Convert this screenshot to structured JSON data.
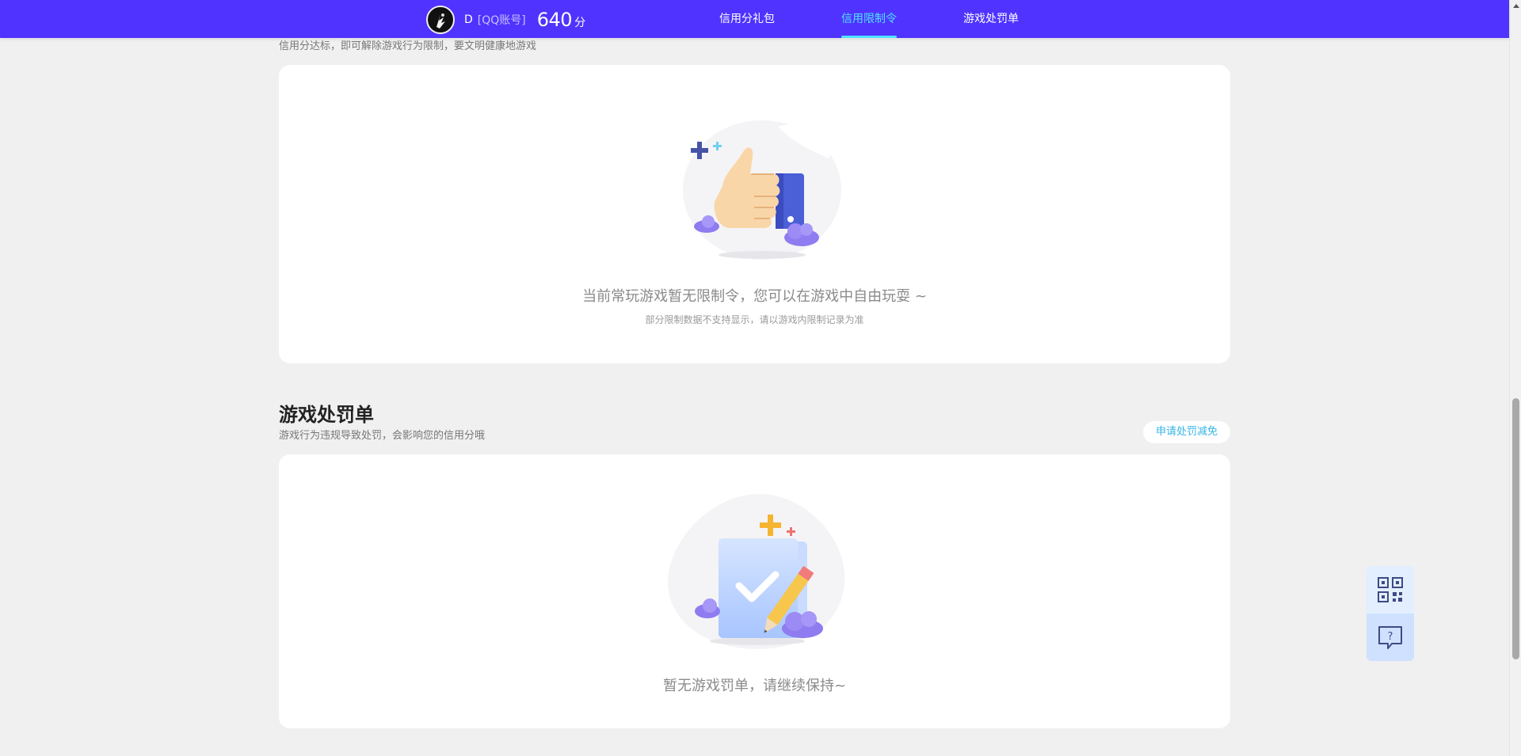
{
  "header": {
    "username": "D",
    "account_type": "[QQ账号]",
    "score": "640",
    "score_unit": "分",
    "tabs": [
      {
        "label": "信用分礼包",
        "active": false
      },
      {
        "label": "信用限制令",
        "active": true
      },
      {
        "label": "游戏处罚单",
        "active": false
      }
    ],
    "accent": "#5033ff",
    "active_color": "#4fe3ff"
  },
  "restriction": {
    "subtitle": "信用分达标，即可解除游戏行为限制，要文明健康地游戏",
    "empty_text": "当前常玩游戏暂无限制令，您可以在游戏中自由玩耍 ~",
    "empty_note": "部分限制数据不支持显示，请以游戏内限制记录为准",
    "illustration_icon": "thumbs-up-illustration"
  },
  "penalty": {
    "title": "游戏处罚单",
    "subtitle": "游戏行为违规导致处罚，会影响您的信用分哦",
    "appeal_label": "申请处罚减免",
    "empty_text": "暂无游戏罚单，请继续保持~",
    "illustration_icon": "clipboard-check-illustration"
  },
  "floating": {
    "qr_icon": "qr-code-icon",
    "help_icon": "help-chat-icon"
  }
}
